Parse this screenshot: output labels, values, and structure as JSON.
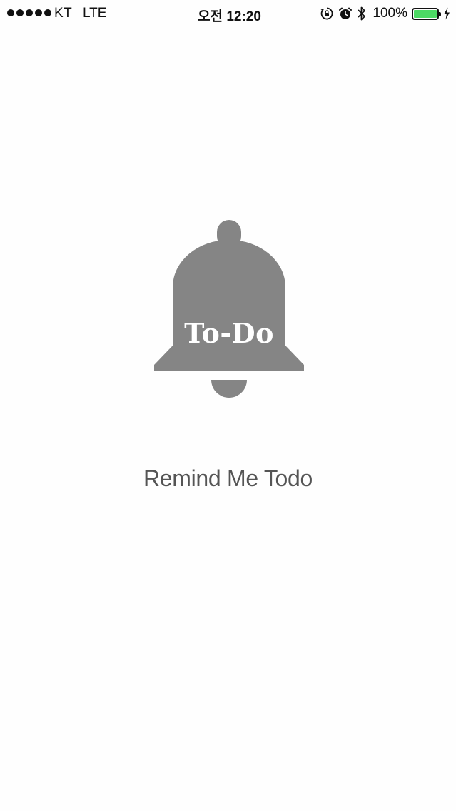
{
  "status_bar": {
    "carrier": "KT",
    "network": "LTE",
    "time": "오전 12:20",
    "battery_percent": "100%",
    "battery_level": 1.0,
    "battery_color": "#4cd964",
    "signal_bars": 5,
    "icons": [
      "rotation-lock-icon",
      "alarm-icon",
      "bluetooth-icon",
      "battery-icon",
      "charging-icon"
    ]
  },
  "splash": {
    "logo_text": "To-Do",
    "logo_color": "#858585",
    "app_name": "Remind Me Todo"
  }
}
